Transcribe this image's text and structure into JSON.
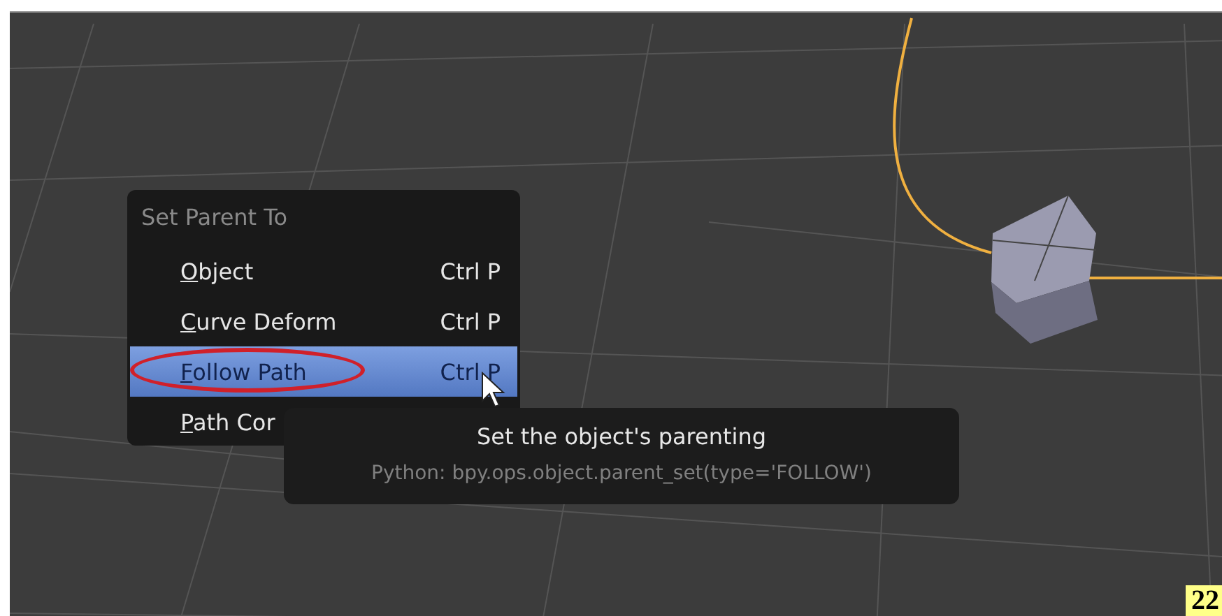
{
  "menu": {
    "title": "Set Parent To",
    "items": [
      {
        "label": "Object",
        "shortcut": "Ctrl P",
        "selected": false,
        "circled": false
      },
      {
        "label": "Curve Deform",
        "shortcut": "Ctrl P",
        "selected": false,
        "circled": false
      },
      {
        "label": "Follow Path",
        "shortcut": "Ctrl P",
        "selected": true,
        "circled": true
      },
      {
        "label": "Path Cor",
        "selected": false,
        "circled": false
      }
    ]
  },
  "tooltip": {
    "description": "Set the object's parenting",
    "python": "Python: bpy.ops.object.parent_set(type='FOLLOW')"
  },
  "page_number": "22"
}
